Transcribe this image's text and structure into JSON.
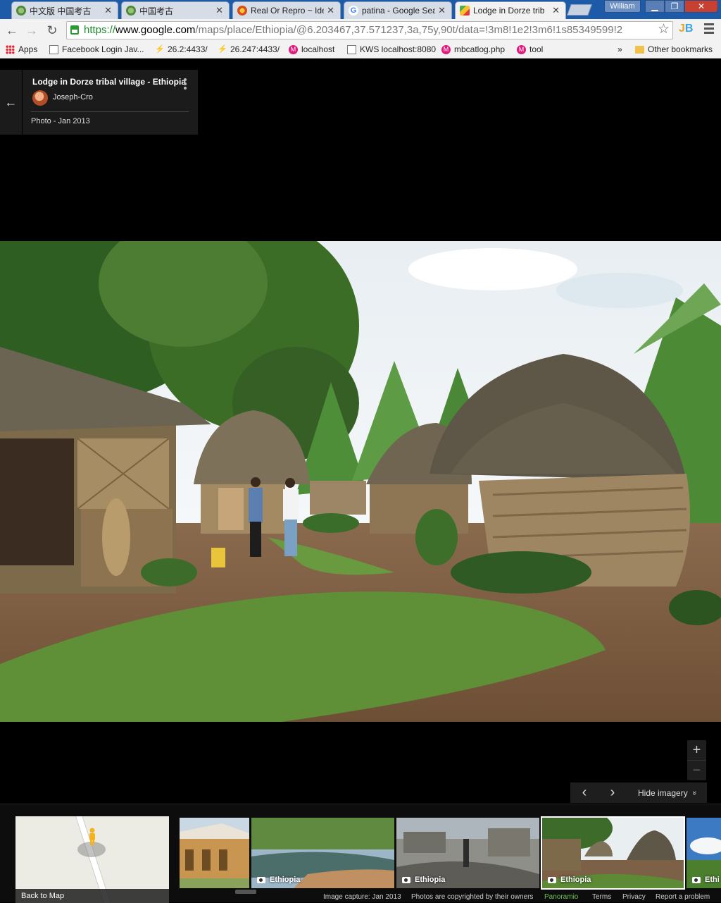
{
  "browser": {
    "tabs": [
      {
        "title": "中文版 中国考古",
        "icon": "globe-icon",
        "active": false
      },
      {
        "title": "中国考古",
        "icon": "globe-icon",
        "active": false
      },
      {
        "title": "Real Or Repro ~ Ide",
        "icon": "site-icon",
        "active": false
      },
      {
        "title": "patina - Google Sea",
        "icon": "google-icon",
        "active": false
      },
      {
        "title": "Lodge in Dorze trib",
        "icon": "maps-icon",
        "active": true
      }
    ],
    "user": "William",
    "url": {
      "protocol": "https://",
      "host": "www.google.com",
      "path": "/maps/place/Ethiopia/@6.203467,37.571237,3a,75y,90t/data=!3m8!1e2!3m6!1s85349599!2"
    },
    "bookmarks": [
      {
        "label": "Apps",
        "icon": "apps-icon"
      },
      {
        "label": "Facebook Login Jav...",
        "icon": "page-icon"
      },
      {
        "label": "26.2:4433/",
        "icon": "link-icon"
      },
      {
        "label": "26.247:4433/",
        "icon": "link-icon"
      },
      {
        "label": "localhost",
        "icon": "m-icon"
      },
      {
        "label": "KWS localhost:8080",
        "icon": "page-icon"
      },
      {
        "label": "mbcatlog.php",
        "icon": "m-icon"
      },
      {
        "label": "tool",
        "icon": "m-icon"
      }
    ],
    "bookmarks_more": "»",
    "other_bookmarks": "Other bookmarks"
  },
  "card": {
    "place": "Lodge in Dorze tribal village - Ethiopia",
    "author": "Joseph-Cro",
    "date": "Photo - Jan 2013"
  },
  "controls": {
    "zoom_in": "+",
    "zoom_out": "−",
    "prev": "‹",
    "next": "›",
    "hide_imagery": "Hide imagery",
    "hide_icon": "»"
  },
  "filmstrip": {
    "back_to_map": "Back to Map",
    "thumbs": [
      {
        "label": ""
      },
      {
        "label": "Ethiopia"
      },
      {
        "label": "Ethiopia"
      },
      {
        "label": "Ethiopia",
        "active": true
      },
      {
        "label": "Ethi"
      }
    ]
  },
  "footer": {
    "capture": "Image capture: Jan 2013",
    "copyright": "Photos are copyrighted by their owners",
    "panoramio": "Panoramio",
    "terms": "Terms",
    "privacy": "Privacy",
    "report": "Report a problem"
  },
  "colors": {
    "accent_green": "#1a8a2a",
    "tab_bar": "#1d5aa8",
    "close_red": "#c84031",
    "panoramio": "#6cc24a"
  }
}
